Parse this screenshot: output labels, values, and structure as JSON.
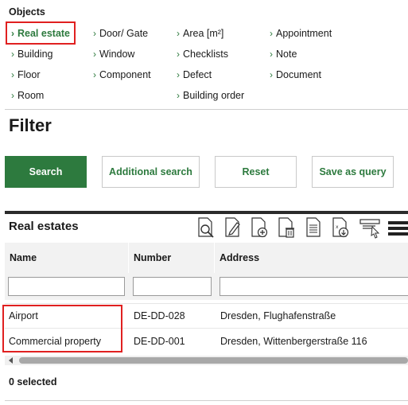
{
  "objects": {
    "title": "Objects",
    "items": [
      {
        "label": "Real estate",
        "active": true
      },
      {
        "label": "Building"
      },
      {
        "label": "Floor"
      },
      {
        "label": "Room"
      },
      {
        "label": "Door/ Gate"
      },
      {
        "label": "Window"
      },
      {
        "label": "Component"
      },
      {
        "label": "Area [m²]"
      },
      {
        "label": "Checklists"
      },
      {
        "label": "Defect"
      },
      {
        "label": "Building order"
      },
      {
        "label": "Appointment"
      },
      {
        "label": "Note"
      },
      {
        "label": "Document"
      }
    ]
  },
  "filter": {
    "title": "Filter",
    "buttons": {
      "search": "Search",
      "additional_search": "Additional search",
      "reset": "Reset",
      "save_as_query": "Save as query"
    }
  },
  "grid": {
    "title": "Real estates",
    "toolbar_icons": [
      "preview-document-icon",
      "edit-document-icon",
      "add-document-icon",
      "delete-document-icon",
      "text-document-icon",
      "export-document-icon",
      "filter-settings-icon",
      "menu-icon"
    ],
    "columns": [
      "Name",
      "Number",
      "Address"
    ],
    "rows": [
      {
        "name": "Airport",
        "number": "DE-DD-028",
        "address": "Dresden, Flughafenstraße"
      },
      {
        "name": "Commercial property",
        "number": "DE-DD-001",
        "address": "Dresden, Wittenbergerstraße 116"
      }
    ],
    "selected_text": "0 selected"
  },
  "colors": {
    "accent": "#2d7a3e",
    "highlight": "#e02020"
  }
}
